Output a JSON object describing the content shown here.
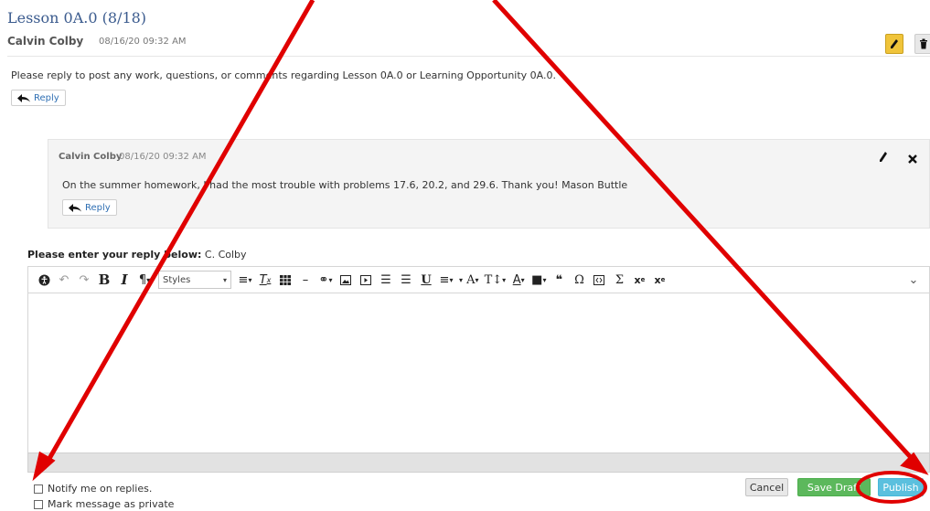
{
  "thread": {
    "title": "Lesson 0A.0 (8/18)",
    "author": "Calvin Colby",
    "date": "08/16/20 09:32 AM",
    "body": "Please reply to post any work, questions, or comments regarding Lesson 0A.0 or Learning Opportunity 0A.0.",
    "reply_label": "Reply"
  },
  "child_post": {
    "author": "Calvin Colby",
    "date": "08/16/20 09:32 AM",
    "body": "On the summer homework, I had the most trouble with problems 17.6, 20.2, and 29.6. Thank you! Mason Buttle",
    "reply_label": "Reply"
  },
  "reply_form": {
    "prompt_label": "Please enter your reply below:",
    "prompt_user": "C. Colby",
    "styles_label": "Styles",
    "notify_label": "Notify me on replies.",
    "private_label": "Mark message as private",
    "cancel_label": "Cancel",
    "save_draft_label": "Save Draft",
    "publish_label": "Publish"
  },
  "toolbar_icons": [
    "accessibility-icon",
    "undo-icon",
    "redo-icon",
    "bold-icon",
    "italic-icon",
    "paragraph-icon",
    "styles-dropdown",
    "align-icon",
    "clear-format-icon",
    "table-icon",
    "horizontal-rule-icon",
    "link-icon",
    "image-icon",
    "media-icon",
    "bullet-list-icon",
    "numbered-list-icon",
    "underline-icon",
    "indent-icon",
    "font-size-icon",
    "line-height-icon",
    "text-color-icon",
    "background-color-icon",
    "blockquote-icon",
    "special-char-icon",
    "code-icon",
    "sum-icon",
    "superscript-icon",
    "subscript-icon",
    "expand-toolbar-icon"
  ],
  "colors": {
    "title": "#3b5b8e",
    "annotation": "#e00000",
    "save_draft": "#5cb85c",
    "publish": "#5bc0de",
    "edit_button": "#f0c43a"
  }
}
